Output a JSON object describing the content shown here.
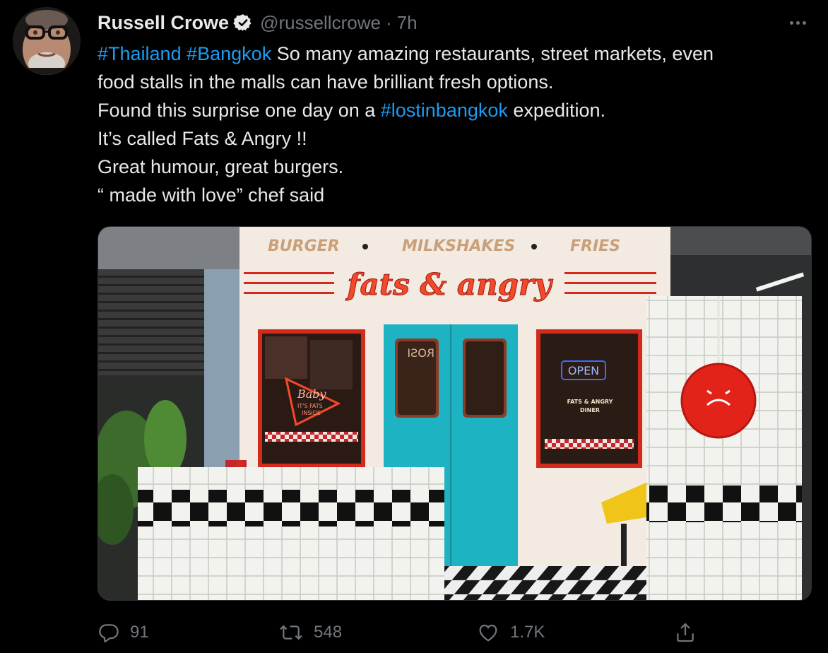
{
  "tweet": {
    "author": {
      "name": "Russell Crowe",
      "handle": "@russellcrowe",
      "time": "7h",
      "separator": "·",
      "verified": true
    },
    "text": {
      "line1": {
        "tag1": "#Thailand",
        "tag2": "#Bangkok",
        "rest": " So many amazing restaurants, street markets, even"
      },
      "line2": "food stalls in the malls can have brilliant fresh options.",
      "line3": {
        "pre": "Found this surprise one day on a ",
        "tag": "#lostinbangkok",
        "post": " expedition."
      },
      "line4": "It’s called Fats & Angry !!",
      "line5": "Great humour, great burgers.",
      "line6": "“ made with love” chef said"
    },
    "media": {
      "sign_top": {
        "item1": "BURGER",
        "item2": "MILKSHAKES",
        "item3": "FRIES"
      },
      "neon_sign": "fats & angry",
      "window_left": {
        "neon1": "Baby",
        "neon2": "IT'S FATS",
        "neon3": "INSIDE"
      },
      "window_right": {
        "open_sign": "OPEN",
        "text1": "FATS & ANGRY",
        "text2": "DINER"
      },
      "door_text": "ROSI"
    },
    "actions": {
      "replies": "91",
      "retweets": "548",
      "likes": "1.7K"
    },
    "colors": {
      "background": "#000000",
      "text": "#e7e9ea",
      "muted": "#71767b",
      "link": "#1d9bf0",
      "door": "#1eb3c2",
      "neon": "#e8321f"
    },
    "icons": [
      "verified-badge-icon",
      "more-icon",
      "reply-icon",
      "retweet-icon",
      "like-icon",
      "share-icon"
    ]
  }
}
